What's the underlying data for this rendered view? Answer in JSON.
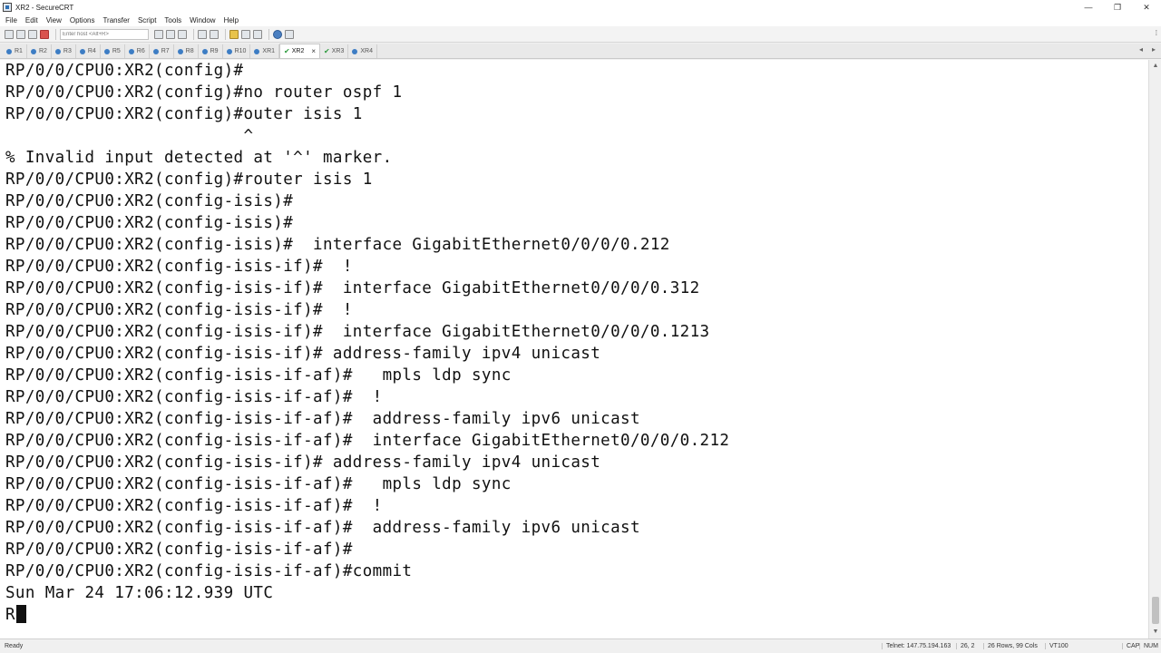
{
  "window": {
    "title": "XR2 - SecureCRT",
    "controls": {
      "minimize": "—",
      "restore": "❐",
      "close": "✕"
    }
  },
  "menu": [
    "File",
    "Edit",
    "View",
    "Options",
    "Transfer",
    "Script",
    "Tools",
    "Window",
    "Help"
  ],
  "toolbar": {
    "host_placeholder": "Enter host <Alt+R>",
    "right_glyph": "⁞"
  },
  "tabs": [
    {
      "label": "R1",
      "active": false,
      "status": "dot"
    },
    {
      "label": "R2",
      "active": false,
      "status": "dot"
    },
    {
      "label": "R3",
      "active": false,
      "status": "dot"
    },
    {
      "label": "R4",
      "active": false,
      "status": "dot"
    },
    {
      "label": "R5",
      "active": false,
      "status": "dot"
    },
    {
      "label": "R6",
      "active": false,
      "status": "dot"
    },
    {
      "label": "R7",
      "active": false,
      "status": "dot"
    },
    {
      "label": "R8",
      "active": false,
      "status": "dot"
    },
    {
      "label": "R9",
      "active": false,
      "status": "dot"
    },
    {
      "label": "R10",
      "active": false,
      "status": "dot"
    },
    {
      "label": "XR1",
      "active": false,
      "status": "dot"
    },
    {
      "label": "XR2",
      "active": true,
      "status": "check"
    },
    {
      "label": "XR3",
      "active": false,
      "status": "check"
    },
    {
      "label": "XR4",
      "active": false,
      "status": "dot"
    }
  ],
  "tab_close": "×",
  "tab_arrows": {
    "left": "◂",
    "right": "▸"
  },
  "terminal": {
    "lines": [
      "RP/0/0/CPU0:XR2(config)#",
      "RP/0/0/CPU0:XR2(config)#no router ospf 1",
      "RP/0/0/CPU0:XR2(config)#outer isis 1",
      "                        ^",
      "% Invalid input detected at '^' marker.",
      "RP/0/0/CPU0:XR2(config)#router isis 1",
      "RP/0/0/CPU0:XR2(config-isis)#",
      "RP/0/0/CPU0:XR2(config-isis)#",
      "RP/0/0/CPU0:XR2(config-isis)#  interface GigabitEthernet0/0/0/0.212",
      "RP/0/0/CPU0:XR2(config-isis-if)#  !",
      "RP/0/0/CPU0:XR2(config-isis-if)#  interface GigabitEthernet0/0/0/0.312",
      "RP/0/0/CPU0:XR2(config-isis-if)#  !",
      "RP/0/0/CPU0:XR2(config-isis-if)#  interface GigabitEthernet0/0/0/0.1213",
      "RP/0/0/CPU0:XR2(config-isis-if)# address-family ipv4 unicast",
      "RP/0/0/CPU0:XR2(config-isis-if-af)#   mpls ldp sync",
      "RP/0/0/CPU0:XR2(config-isis-if-af)#  !",
      "RP/0/0/CPU0:XR2(config-isis-if-af)#  address-family ipv6 unicast",
      "RP/0/0/CPU0:XR2(config-isis-if-af)#  interface GigabitEthernet0/0/0/0.212",
      "RP/0/0/CPU0:XR2(config-isis-if)# address-family ipv4 unicast",
      "RP/0/0/CPU0:XR2(config-isis-if-af)#   mpls ldp sync",
      "RP/0/0/CPU0:XR2(config-isis-if-af)#  !",
      "RP/0/0/CPU0:XR2(config-isis-if-af)#  address-family ipv6 unicast",
      "RP/0/0/CPU0:XR2(config-isis-if-af)#",
      "RP/0/0/CPU0:XR2(config-isis-if-af)#commit",
      "Sun Mar 24 17:06:12.939 UTC"
    ],
    "current_input": "R"
  },
  "scrollbar": {
    "up": "▲",
    "down": "▼"
  },
  "status": {
    "ready": "Ready",
    "connection": "Telnet: 147.75.194.163",
    "cursor_pos": "26,  2",
    "size": "26 Rows, 99 Cols",
    "emulation": "VT100",
    "caps": "CAP",
    "num": "NUM"
  }
}
